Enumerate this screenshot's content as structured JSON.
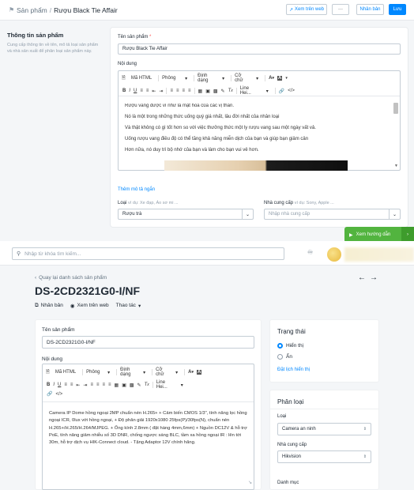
{
  "top": {
    "breadcrumb_parent": "Sản phẩm",
    "breadcrumb_sep": "/",
    "title": "Rượu Black Tie Affair",
    "view_web": "Xem trên web",
    "more": "···",
    "duplicate": "Nhân bản",
    "save": "Lưu"
  },
  "info": {
    "heading": "Thông tin sản phẩm",
    "desc": "Cung cấp thông tin về tên, mô tả loại sản phẩm và nhà sản xuất để phân loại sản phẩm này.",
    "name_label": "Tên sản phẩm",
    "required": "*",
    "name_value": "Rượu Black Tie Affair",
    "content_label": "Nội dung",
    "toolbar": {
      "html": "Mã HTML",
      "font": "Phông",
      "format": "Định dạng",
      "size": "Cỡ chữ",
      "line_height": "Line Hei..."
    },
    "content_lines": [
      "Rượu vang được ví như là mật hoa của các vị thần.",
      "Nó là một trong những thức uống quý giá nhất, lâu đời nhất của nhân loại",
      "Và thật không có gì tốt hơn so với việc thưởng thức một ly rượu vang sau một ngày vất vả.",
      "Uống rượu vang điều độ có thể tăng khả năng miễn dịch của bạn và giúp bạn giảm cân",
      "Hơn nữa, nó duy trì bộ nhớ của bạn và làm cho bạn vui vẻ hơn."
    ],
    "add_summary": "Thêm mô tả ngắn",
    "type_label": "Loại",
    "type_hint": "ví dụ: Xe đạp, Áo sơ mi ...",
    "type_value": "Rượu trà",
    "vendor_label": "Nhà cung cấp",
    "vendor_hint": "ví dụ: Sony, Apple ...",
    "vendor_placeholder": "Nhập nhà cung cấp",
    "guide": "Xem hướng dẫn"
  },
  "bottom": {
    "search_placeholder": "Nhập từ khóa tìm kiếm...",
    "back": "Quay lại danh sách sản phẩm",
    "product_title": "DS-2CD2321G0-I/NF",
    "action_duplicate": "Nhân bản",
    "action_view": "Xem trên web",
    "action_more": "Thao tác",
    "name_label": "Tên sản phẩm",
    "name_value": "DS-2CD2321G0-I/NF",
    "content_label": "Nội dung",
    "content_text": "Camera IP Dome hồng ngoại 2MP chuẩn nén H.265+ + Cảm biến CMOS 1/3\", tính năng lọc hồng ngoại ICR, 0lux với hồng ngoại, + Độ phân giải 1920x1080 25fps(P)/30fps(N), chuẩn nén H.265+/H.265/H.264/MJPEG. + Ống kính 2.8mm ( đặt hàng 4mm,6mm) + Nguồn DC12V & hỗ trợ PoE, tính năng giảm nhiễu số 3D DNR, chống ngược sáng BLC, tầm xa hồng ngoại IR : lên tới 30m, hỗ trợ dịch vụ HIK-Connect cloud. - Tặng Adaptor 12V chính hãng.",
    "status_heading": "Trạng thái",
    "status_shown": "Hiển thị",
    "status_hidden": "Ẩn",
    "schedule": "Đặt lịch hiển thị",
    "classify_heading": "Phân loại",
    "type_label": "Loại",
    "type_value": "Camera an ninh",
    "vendor_label": "Nhà cung cấp",
    "vendor_value": "Hikvision",
    "category_label": "Danh mục"
  }
}
